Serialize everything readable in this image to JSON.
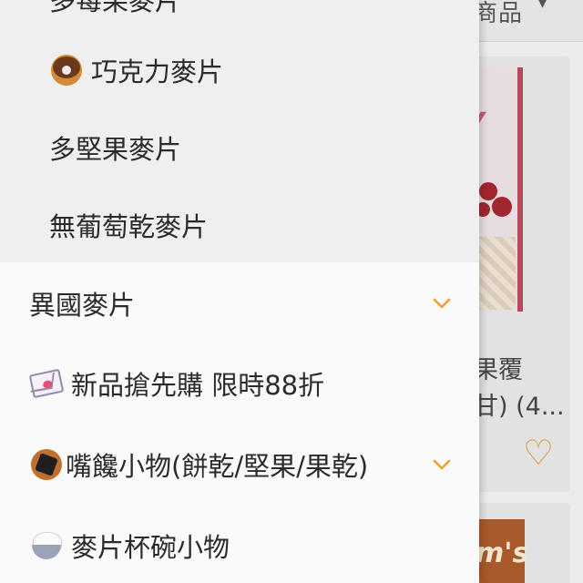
{
  "background": {
    "sort_label": "商品",
    "product_title_line1": "果覆",
    "product_title_line2": "甘) (4...",
    "accent_color": "#d29a3a"
  },
  "drawer": {
    "top_partial_label": "多莓果麥片",
    "sub_items": [
      {
        "label": "巧克力麥片",
        "icon": "donut-icon"
      },
      {
        "label": "多堅果麥片"
      },
      {
        "label": "無葡萄乾麥片"
      }
    ],
    "main_items": [
      {
        "label": "異國麥片",
        "expandable": true
      },
      {
        "label": "新品搶先購 限時88折",
        "icon": "love-letter-icon"
      },
      {
        "label": "嘴饞小物(餅乾/堅果/果乾)",
        "icon": "rice-cracker-icon",
        "expandable": true
      },
      {
        "label": "麥片杯碗小物",
        "icon": "rice-bowl-icon"
      }
    ],
    "chevron_color": "#f0a030"
  }
}
